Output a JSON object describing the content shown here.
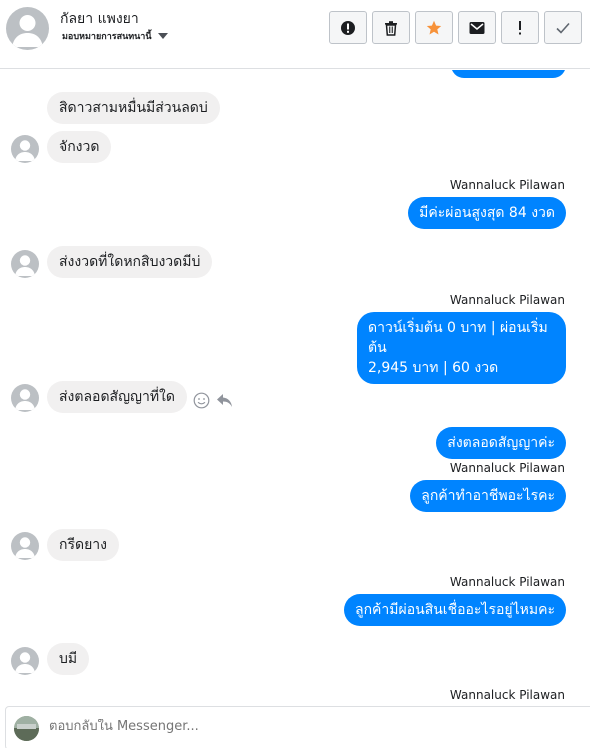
{
  "header": {
    "contact_name": "กัลยา แพงยา",
    "assign_label": "มอบหมายการสนทนานี้",
    "toolbar": {
      "spam": "spam-icon",
      "delete": "trash-icon",
      "star": "star-icon",
      "unread": "envelope-icon",
      "follow_up": "exclamation-icon",
      "done": "check-icon"
    },
    "colors": {
      "star": "#f7923a",
      "button_border": "#bec3c9"
    }
  },
  "thread": {
    "top_partial": "",
    "messages": [
      {
        "dir": "in",
        "text": "สิดาวสามหมื่นมีส่วนลดบ่"
      },
      {
        "dir": "in",
        "text": "จักงวด"
      },
      {
        "dir": "out",
        "sender": "Wannaluck Pilawan",
        "text": "มีค่ะผ่อนสูงสุด 84 งวด"
      },
      {
        "dir": "in",
        "text": "ส่งงวดที่ใดหกสิบงวดมีบ่"
      },
      {
        "dir": "out",
        "sender": "Wannaluck Pilawan",
        "line1": "ดาวน์เริ่มต้น 0 บาท | ผ่อนเริ่มต้น",
        "line2": "2,945  บาท | 60 งวด"
      },
      {
        "dir": "in",
        "text": "ส่งตลอดสัญญาที่ใด"
      },
      {
        "dir": "out",
        "text": "ส่งตลอดสัญญาค่ะ"
      },
      {
        "dir": "out",
        "sender": "Wannaluck Pilawan",
        "text": "ลูกค้าทำอาชีพอะไรคะ"
      },
      {
        "dir": "in",
        "text": "กรีดยาง"
      },
      {
        "dir": "out",
        "sender": "Wannaluck Pilawan",
        "text": "ลูกค้ามีผ่อนสินเชื่ออะไรอยู่ไหมคะ"
      },
      {
        "dir": "in",
        "text": "บมี"
      },
      {
        "dir": "out",
        "sender": "Wannaluck Pilawan"
      }
    ],
    "bubble_colors": {
      "incoming": "#f1f0f0",
      "outgoing": "#0084ff"
    }
  },
  "composer": {
    "placeholder": "ตอบกลับใน Messenger..."
  }
}
